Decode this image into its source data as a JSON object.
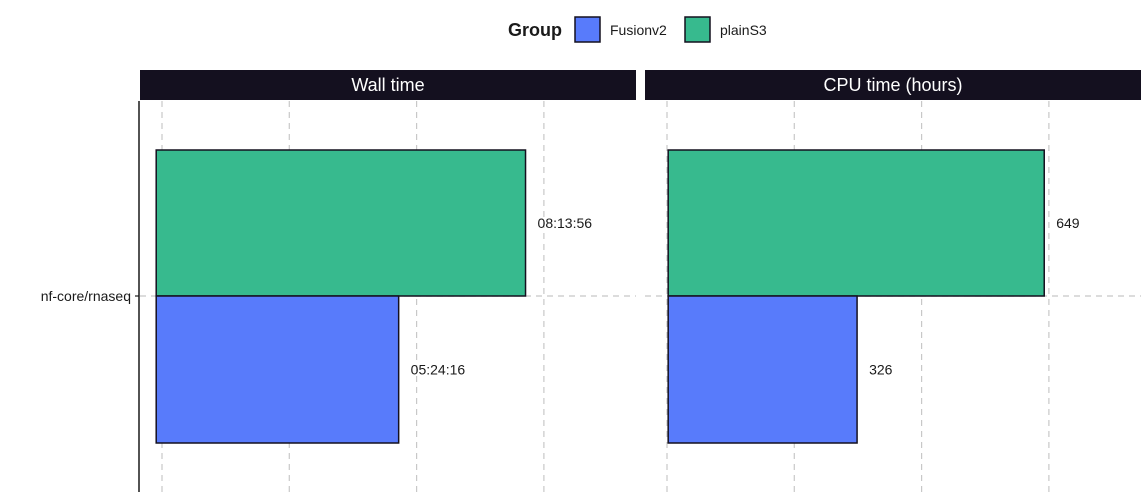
{
  "colors": {
    "strip_bg": "#14101f",
    "grid": "#c8c8c8",
    "axis": "#1a1a1a",
    "bar_stroke": "#14101f"
  },
  "chart_data": {
    "type": "bar",
    "orientation": "horizontal",
    "legend": {
      "title": "Group",
      "placement": "top",
      "entries": [
        {
          "name": "Fusionv2",
          "color": "#587bfb"
        },
        {
          "name": "plainS3",
          "color": "#37ba8e"
        }
      ]
    },
    "categories": [
      "nf-core/rnaseq"
    ],
    "grid": true,
    "panels": [
      {
        "title": "Wall time",
        "unit": "seconds",
        "xlim": [
          -1300,
          38500
        ],
        "series": [
          {
            "name": "plainS3",
            "values": [
              29636
            ],
            "labels": [
              "08:13:56"
            ]
          },
          {
            "name": "Fusionv2",
            "values": [
              19456
            ],
            "labels": [
              "05:24:16"
            ]
          }
        ]
      },
      {
        "title": "CPU time (hours)",
        "unit": "hours",
        "xlim": [
          -40,
          816
        ],
        "series": [
          {
            "name": "plainS3",
            "values": [
              649
            ],
            "labels": [
              "649"
            ]
          },
          {
            "name": "Fusionv2",
            "values": [
              326
            ],
            "labels": [
              "326"
            ]
          }
        ]
      }
    ]
  }
}
